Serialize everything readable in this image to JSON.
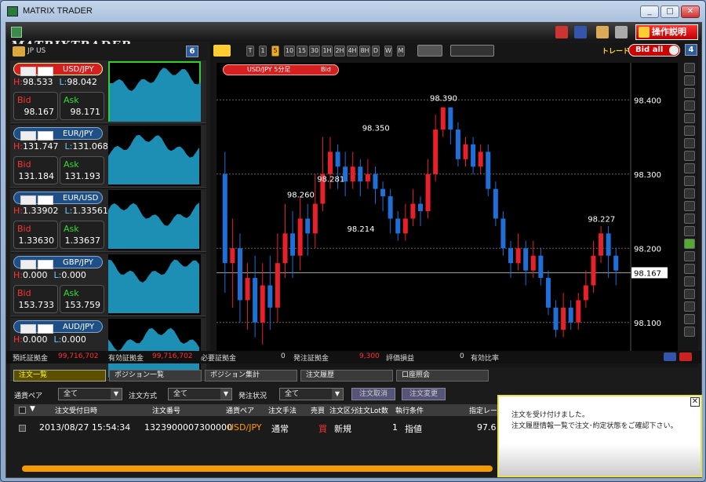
{
  "window": {
    "title": "MATRIX TRADER",
    "min": "_",
    "max": "□",
    "close": "✕"
  },
  "toolbar": {
    "logo": "MATRIXTRADER",
    "help_label": "操作説明"
  },
  "left": {
    "flags_text": "🇯🇵🇺🇸",
    "badge": "6",
    "pairs": [
      {
        "name": "USD/JPY",
        "high": "98.533",
        "low": "98.042",
        "bid": "98.167",
        "ask": "98.171",
        "style": "usd",
        "selected": true
      },
      {
        "name": "EUR/JPY",
        "high": "131.747",
        "low": "131.068",
        "bid": "131.184",
        "ask": "131.193",
        "style": "blue",
        "selected": false
      },
      {
        "name": "EUR/USD",
        "high": "1.33902",
        "low": "1.33561",
        "bid": "1.33630",
        "ask": "1.33637",
        "style": "blue",
        "selected": false
      },
      {
        "name": "GBP/JPY",
        "high": "0.000",
        "low": "0.000",
        "bid": "153.733",
        "ask": "153.759",
        "style": "blue",
        "selected": false
      },
      {
        "name": "AUD/JPY",
        "high": "0.000",
        "low": "0.000",
        "bid": "",
        "ask": "",
        "style": "blue",
        "selected": false
      }
    ],
    "h_label": "H:",
    "l_label": "L:",
    "bid_label": "Bid",
    "ask_label": "Ask"
  },
  "chart": {
    "timeframes": [
      "T",
      "1",
      "5",
      "10",
      "15",
      "30",
      "1H",
      "2H",
      "4H",
      "8H",
      "D",
      "W",
      "M"
    ],
    "selected_tf": "5",
    "trade_label": "トレード",
    "bidall_label": "Bid all",
    "badge": "4",
    "tag": "USD/JPY 5分足",
    "tag_side": "Bid",
    "y_ticks": [
      "98.400",
      "98.300",
      "98.200",
      "98.100"
    ],
    "current_price": "98.167",
    "annotations": [
      "98.390",
      "98.350",
      "98.260",
      "98.281",
      "98.214",
      "98.227"
    ]
  },
  "chart_data": {
    "type": "candlestick",
    "ylim": [
      98.05,
      98.45
    ],
    "y_ticks": [
      98.4,
      98.3,
      98.2,
      98.1
    ],
    "current": 98.167,
    "candles": [
      [
        98.3,
        98.18,
        98.33,
        98.14
      ],
      [
        98.18,
        98.2,
        98.24,
        98.12
      ],
      [
        98.2,
        98.13,
        98.22,
        98.1
      ],
      [
        98.13,
        98.16,
        98.18,
        98.09
      ],
      [
        98.16,
        98.1,
        98.19,
        98.08
      ],
      [
        98.1,
        98.15,
        98.18,
        98.07
      ],
      [
        98.15,
        98.12,
        98.19,
        98.09
      ],
      [
        98.12,
        98.18,
        98.22,
        98.1
      ],
      [
        98.18,
        98.22,
        98.26,
        98.16
      ],
      [
        98.22,
        98.19,
        98.25,
        98.16
      ],
      [
        98.19,
        98.24,
        98.27,
        98.17
      ],
      [
        98.24,
        98.22,
        98.26,
        98.19
      ],
      [
        98.22,
        98.26,
        98.3,
        98.2
      ],
      [
        98.26,
        98.3,
        98.35,
        98.25
      ],
      [
        98.3,
        98.33,
        98.35,
        98.28
      ],
      [
        98.33,
        98.31,
        98.34,
        98.28
      ],
      [
        98.31,
        98.29,
        98.33,
        98.27
      ],
      [
        98.29,
        98.31,
        98.33,
        98.28
      ],
      [
        98.31,
        98.29,
        98.32,
        98.27
      ],
      [
        98.29,
        98.3,
        98.32,
        98.28
      ],
      [
        98.3,
        98.28,
        98.31,
        98.26
      ],
      [
        98.28,
        98.27,
        98.29,
        98.25
      ],
      [
        98.27,
        98.24,
        98.28,
        98.22
      ],
      [
        98.24,
        98.22,
        98.25,
        98.21
      ],
      [
        98.22,
        98.24,
        98.26,
        98.21
      ],
      [
        98.24,
        98.26,
        98.28,
        98.23
      ],
      [
        98.26,
        98.25,
        98.27,
        98.23
      ],
      [
        98.25,
        98.3,
        98.32,
        98.24
      ],
      [
        98.3,
        98.36,
        98.38,
        98.29
      ],
      [
        98.36,
        98.39,
        98.39,
        98.35
      ],
      [
        98.39,
        98.36,
        98.39,
        98.34
      ],
      [
        98.36,
        98.32,
        98.37,
        98.31
      ],
      [
        98.32,
        98.34,
        98.35,
        98.31
      ],
      [
        98.34,
        98.31,
        98.35,
        98.3
      ],
      [
        98.31,
        98.33,
        98.34,
        98.3
      ],
      [
        98.33,
        98.28,
        98.34,
        98.27
      ],
      [
        98.28,
        98.24,
        98.29,
        98.23
      ],
      [
        98.24,
        98.2,
        98.25,
        98.19
      ],
      [
        98.2,
        98.18,
        98.21,
        98.16
      ],
      [
        98.18,
        98.2,
        98.22,
        98.17
      ],
      [
        98.2,
        98.17,
        98.21,
        98.15
      ],
      [
        98.17,
        98.19,
        98.21,
        98.16
      ],
      [
        98.19,
        98.16,
        98.2,
        98.15
      ],
      [
        98.16,
        98.12,
        98.17,
        98.11
      ],
      [
        98.12,
        98.09,
        98.13,
        98.08
      ],
      [
        98.09,
        98.12,
        98.14,
        98.08
      ],
      [
        98.12,
        98.1,
        98.13,
        98.09
      ],
      [
        98.1,
        98.13,
        98.14,
        98.09
      ],
      [
        98.13,
        98.15,
        98.17,
        98.12
      ],
      [
        98.15,
        98.19,
        98.21,
        98.14
      ],
      [
        98.19,
        98.22,
        98.23,
        98.18
      ],
      [
        98.22,
        98.19,
        98.23,
        98.16
      ],
      [
        98.19,
        98.17,
        98.2,
        98.15
      ]
    ]
  },
  "status": {
    "deposit_label": "預託証拠金",
    "deposit": "99,716,702",
    "effective_label": "有効証拠金",
    "effective": "99,716,702",
    "required_label": "必要証拠金",
    "required": "0",
    "order_label": "発注証拠金",
    "order": "9,300",
    "pnl_label": "評価損益",
    "pnl": "0",
    "ratio_label": "有効比率"
  },
  "tabs": [
    "注文一覧",
    "ポジション一覧",
    "ポジション集計",
    "注文履歴",
    "口座照会"
  ],
  "filters": {
    "pair_label": "通貨ペア",
    "pair_value": "全て",
    "method_label": "注文方式",
    "method_value": "全て",
    "status_label": "発注状況",
    "status_value": "全て",
    "cancel_btn": "注文取消",
    "change_btn": "注文変更"
  },
  "table": {
    "headers": [
      "注文受付日時",
      "注文番号",
      "通貨ペア",
      "注文手法",
      "売買",
      "注文区分",
      "注文Lot数",
      "執行条件",
      "指定レー"
    ],
    "row": [
      "2013/08/27 15:54:34",
      "1323900007300000",
      "USD/JPY",
      "通常",
      "買",
      "新規",
      "1",
      "指値",
      "97.6"
    ]
  },
  "popup": {
    "line1": "注文を受け付けました。",
    "line2": "注文履歴情報一覧で注文･約定状態をご確認下さい。",
    "close": "✕"
  }
}
